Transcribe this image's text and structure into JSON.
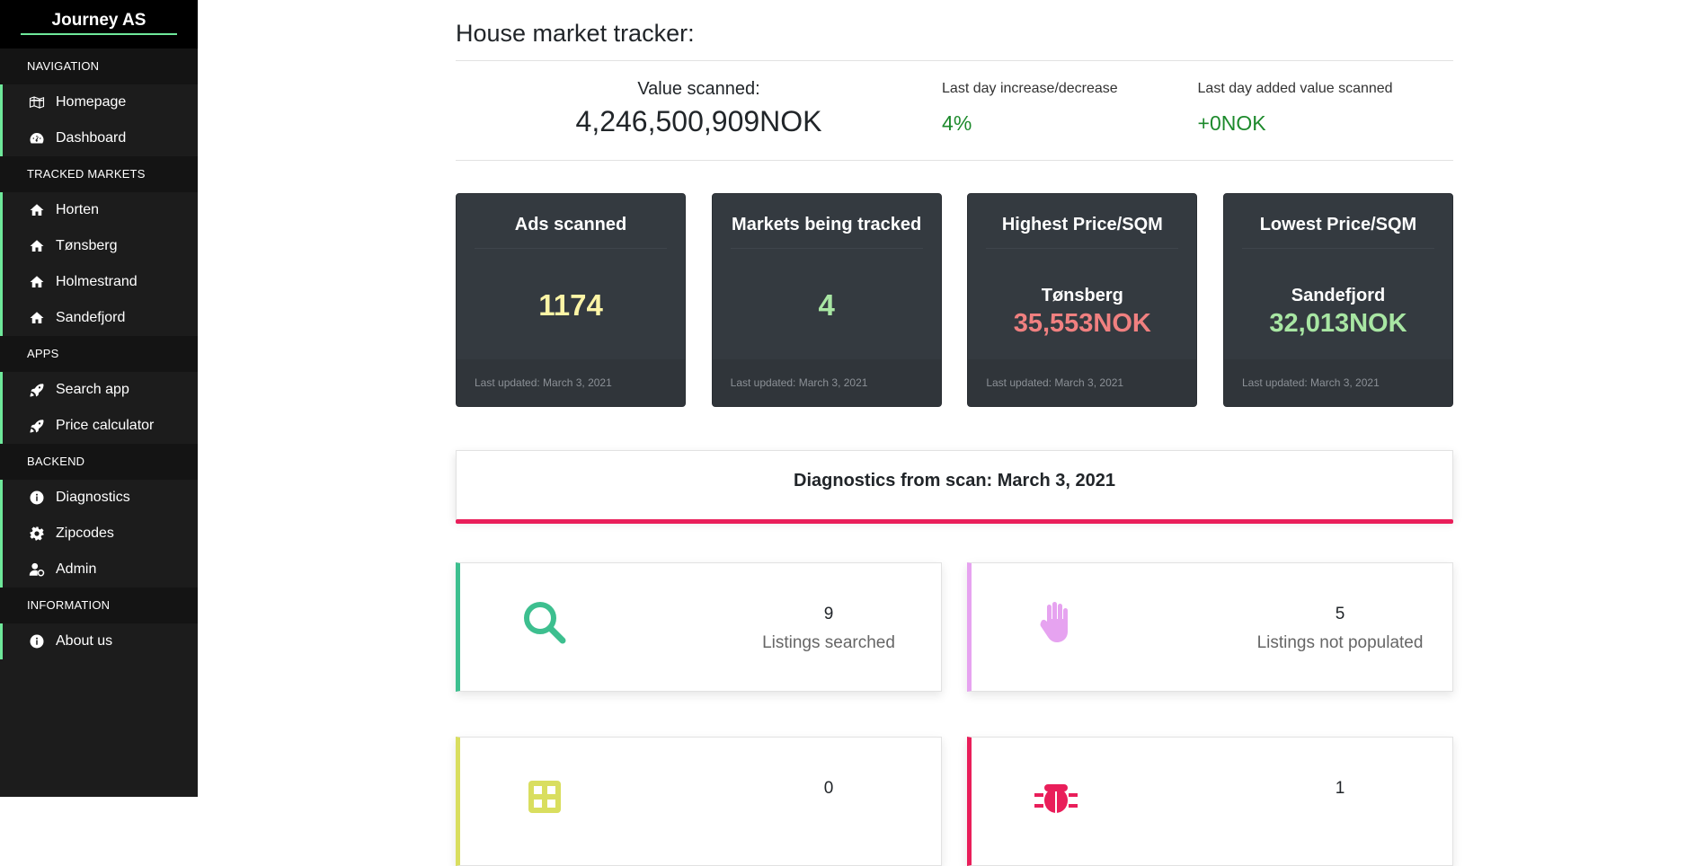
{
  "brand": "Journey AS",
  "sidebar": {
    "sections": [
      {
        "heading": "NAVIGATION",
        "items": [
          {
            "label": "Homepage",
            "icon": "map-icon"
          },
          {
            "label": "Dashboard",
            "icon": "gauge-icon"
          }
        ]
      },
      {
        "heading": "TRACKED MARKETS",
        "items": [
          {
            "label": "Horten",
            "icon": "home-icon"
          },
          {
            "label": "Tønsberg",
            "icon": "home-icon"
          },
          {
            "label": "Holmestrand",
            "icon": "home-icon"
          },
          {
            "label": "Sandefjord",
            "icon": "home-icon"
          }
        ]
      },
      {
        "heading": "APPS",
        "items": [
          {
            "label": "Search app",
            "icon": "rocket-icon"
          },
          {
            "label": "Price calculator",
            "icon": "rocket-icon"
          }
        ]
      },
      {
        "heading": "BACKEND",
        "items": [
          {
            "label": "Diagnostics",
            "icon": "info-icon"
          },
          {
            "label": "Zipcodes",
            "icon": "gear-icon"
          },
          {
            "label": "Admin",
            "icon": "user-cog-icon"
          }
        ]
      },
      {
        "heading": "INFORMATION",
        "items": [
          {
            "label": "About us",
            "icon": "info-icon"
          }
        ]
      }
    ]
  },
  "main": {
    "title": "House market tracker:",
    "summary": {
      "value_label": "Value scanned:",
      "value": "4,246,500,909NOK",
      "change_label": "Last day increase/decrease",
      "change_value": "4%",
      "added_label": "Last day added value scanned",
      "added_value": "+0NOK"
    },
    "cards": [
      {
        "title": "Ads scanned",
        "value": "1174",
        "value_color": "#fdf5a6",
        "footer": "Last updated: March 3, 2021"
      },
      {
        "title": "Markets being tracked",
        "value": "4",
        "value_color": "#a8e6a3",
        "footer": "Last updated: March 3, 2021"
      },
      {
        "title": "Highest Price/SQM",
        "city": "Tønsberg",
        "price": "35,553NOK",
        "price_color": "#f08080",
        "footer": "Last updated: March 3, 2021"
      },
      {
        "title": "Lowest Price/SQM",
        "city": "Sandefjord",
        "price": "32,013NOK",
        "price_color": "#a8e6a3",
        "footer": "Last updated: March 3, 2021"
      }
    ],
    "diagnostics_title": "Diagnostics from scan: March 3, 2021",
    "stats": [
      {
        "value": "9",
        "label": "Listings searched",
        "icon": "search-icon",
        "color": "#3dbf8f"
      },
      {
        "value": "5",
        "label": "Listings not populated",
        "icon": "hand-icon",
        "color": "#e6a3f0"
      },
      {
        "value": "0",
        "label": "",
        "icon": "grid-icon",
        "color": "#d9de5f"
      },
      {
        "value": "1",
        "label": "",
        "icon": "bug-icon",
        "color": "#e91e5a"
      }
    ]
  }
}
